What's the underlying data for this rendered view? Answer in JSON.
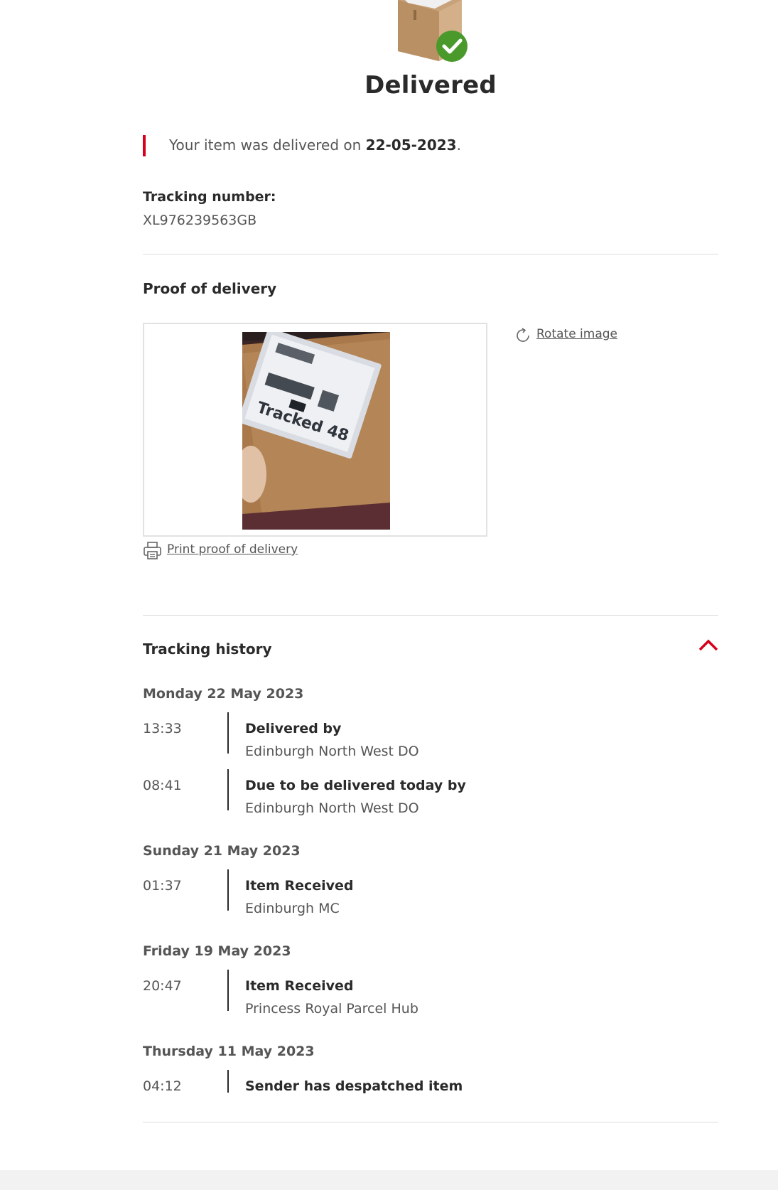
{
  "status": {
    "title": "Delivered",
    "message_prefix": "Your item was delivered on ",
    "delivered_date": "22-05-2023",
    "message_suffix": "."
  },
  "tracking": {
    "label": "Tracking number:",
    "number": "XL976239563GB"
  },
  "proof": {
    "heading": "Proof of delivery",
    "rotate_label": "Rotate image",
    "print_label": "Print proof of delivery",
    "label_photo_text": "Tracked 48"
  },
  "history": {
    "heading": "Tracking history",
    "days": [
      {
        "date": "Monday 22 May 2023",
        "events": [
          {
            "time": "13:33",
            "title": "Delivered by",
            "location": "Edinburgh North West DO"
          },
          {
            "time": "08:41",
            "title": "Due to be delivered today by",
            "location": "Edinburgh North West DO"
          }
        ]
      },
      {
        "date": "Sunday 21 May 2023",
        "events": [
          {
            "time": "01:37",
            "title": "Item Received",
            "location": "Edinburgh MC"
          }
        ]
      },
      {
        "date": "Friday 19 May 2023",
        "events": [
          {
            "time": "20:47",
            "title": "Item Received",
            "location": "Princess Royal Parcel Hub"
          }
        ]
      },
      {
        "date": "Thursday 11 May 2023",
        "events": [
          {
            "time": "04:12",
            "title": "Sender has despatched item",
            "location": ""
          }
        ]
      }
    ]
  },
  "colors": {
    "accent_red": "#d6001c",
    "success_green": "#4a9a2b",
    "text_dark": "#2a2a2a",
    "text_muted": "#555555"
  },
  "icons": {
    "hero": "parcel-box-check-icon",
    "rotate": "rotate-icon",
    "print": "printer-icon",
    "toggle": "chevron-up-icon"
  }
}
